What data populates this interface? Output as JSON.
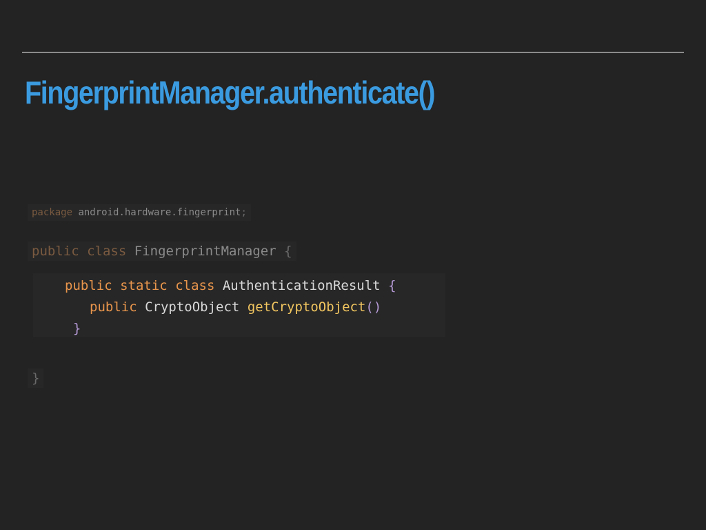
{
  "slide": {
    "title": "FingerprintManager.authenticate()"
  },
  "code": {
    "package_line": {
      "keyword": "package",
      "name": "android.hardware.fingerprint",
      "semicolon": ";"
    },
    "class_line": {
      "keyword1": "public",
      "keyword2": "class",
      "name": "FingerprintManager",
      "brace": "{"
    },
    "inner_class_line": {
      "keyword1": "public",
      "keyword2": "static",
      "keyword3": "class",
      "name": "AuthenticationResult",
      "brace": "{"
    },
    "method_line": {
      "keyword": "public",
      "type": "CryptoObject",
      "method": "getCryptoObject",
      "parens": "()"
    },
    "inner_close": "}",
    "outer_close": "}"
  },
  "colors": {
    "background": "#232323",
    "title": "#3b9be0",
    "keyword": "#e8954c",
    "identifier": "#d9d9d9",
    "method": "#f2c660",
    "punctuation": "#b59ad6"
  }
}
